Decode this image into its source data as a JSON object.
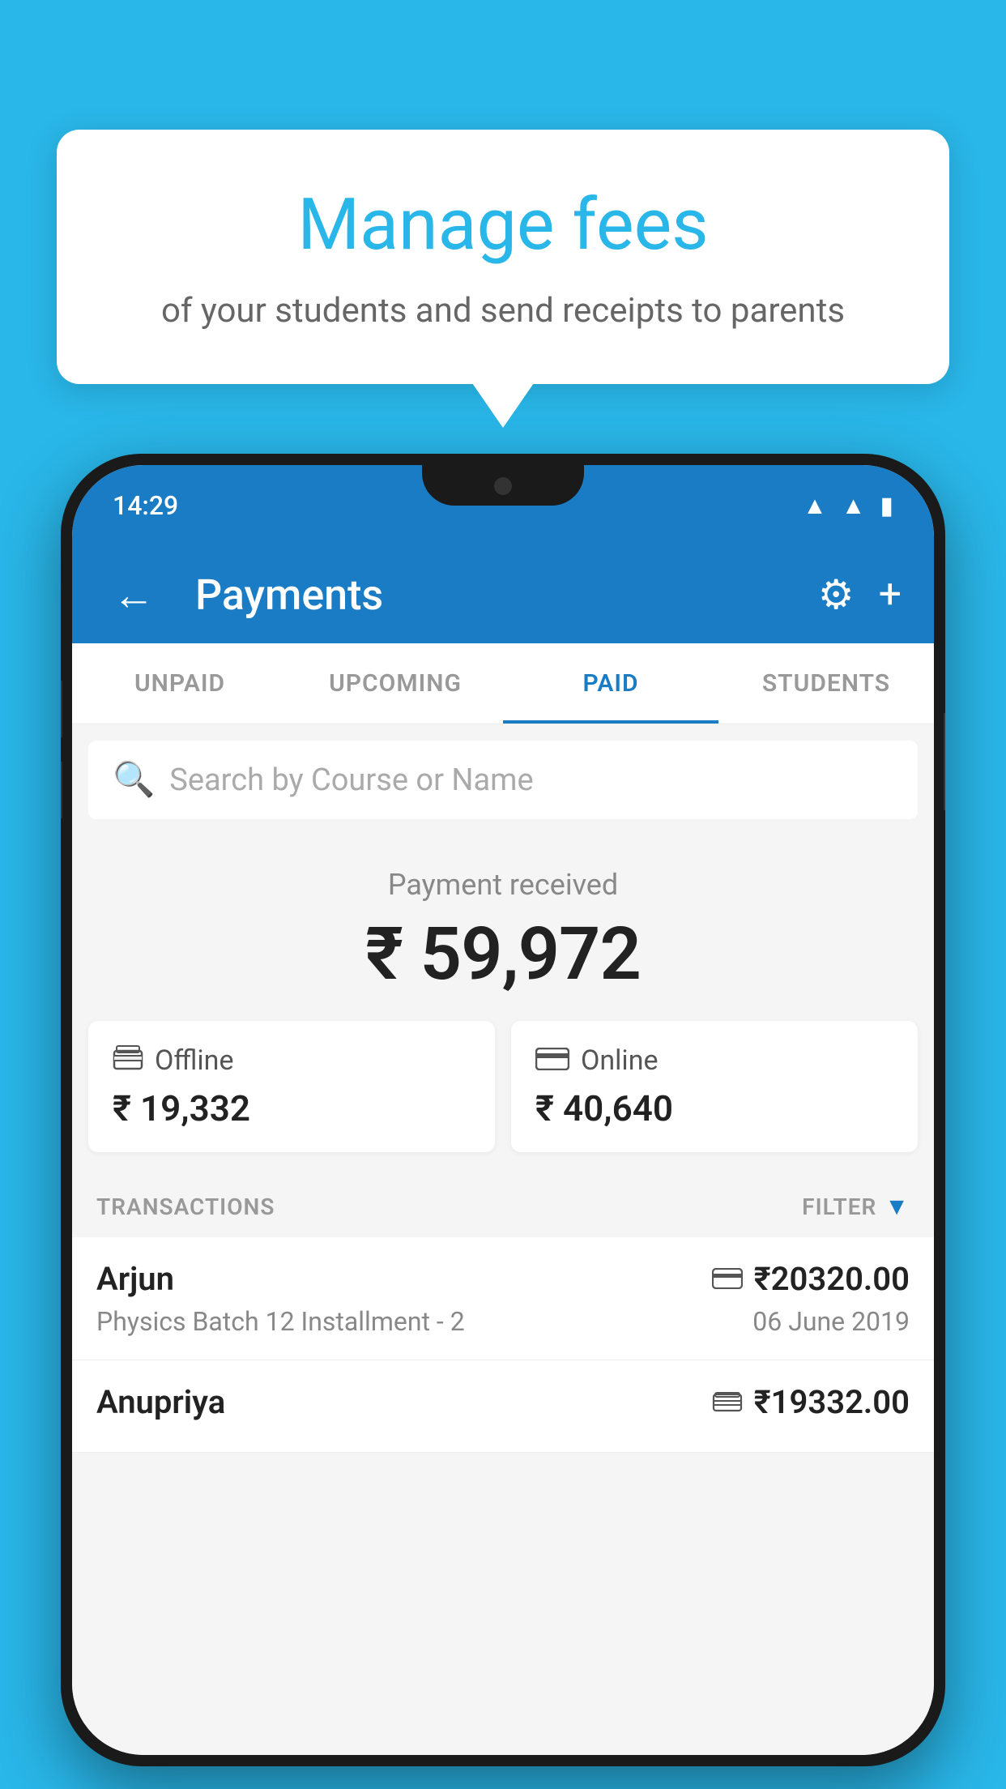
{
  "tooltip": {
    "title": "Manage fees",
    "subtitle": "of your students and send receipts to parents"
  },
  "status_bar": {
    "time": "14:29"
  },
  "header": {
    "title": "Payments",
    "back_label": "←",
    "settings_label": "⚙",
    "add_label": "+"
  },
  "tabs": [
    {
      "label": "UNPAID",
      "active": false
    },
    {
      "label": "UPCOMING",
      "active": false
    },
    {
      "label": "PAID",
      "active": true
    },
    {
      "label": "STUDENTS",
      "active": false
    }
  ],
  "search": {
    "placeholder": "Search by Course or Name"
  },
  "payment_summary": {
    "label": "Payment received",
    "amount": "₹ 59,972"
  },
  "payment_cards": [
    {
      "type": "Offline",
      "icon": "💳",
      "amount": "₹ 19,332"
    },
    {
      "type": "Online",
      "icon": "💳",
      "amount": "₹ 40,640"
    }
  ],
  "transactions": {
    "label": "TRANSACTIONS",
    "filter_label": "FILTER"
  },
  "transaction_list": [
    {
      "name": "Arjun",
      "detail": "Physics Batch 12 Installment - 2",
      "amount": "₹20320.00",
      "date": "06 June 2019",
      "icon": "💳"
    },
    {
      "name": "Anupriya",
      "detail": "",
      "amount": "₹19332.00",
      "date": "",
      "icon": "💳"
    }
  ]
}
